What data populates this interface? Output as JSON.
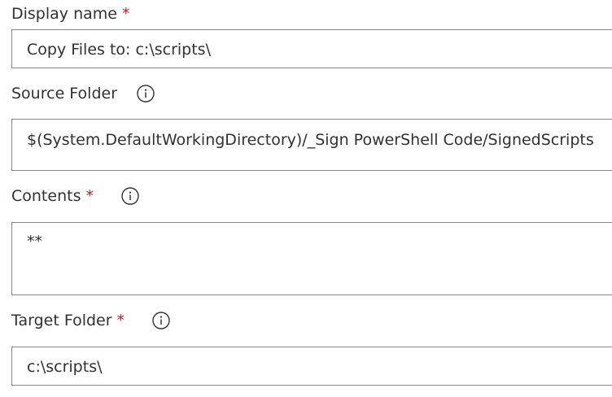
{
  "fields": {
    "display_name": {
      "label": "Display name",
      "required_mark": "*",
      "value": "Copy Files to: c:\\scripts\\"
    },
    "source_folder": {
      "label": "Source Folder",
      "value": "$(System.DefaultWorkingDirectory)/_Sign PowerShell Code/SignedScripts"
    },
    "contents": {
      "label": "Contents",
      "required_mark": "*",
      "value": "**"
    },
    "target_folder": {
      "label": "Target Folder",
      "required_mark": "*",
      "value": "c:\\scripts\\"
    }
  },
  "icons": {
    "info": "info-icon"
  },
  "colors": {
    "required": "#a4262c",
    "border": "#8a8886",
    "text": "#323130"
  }
}
